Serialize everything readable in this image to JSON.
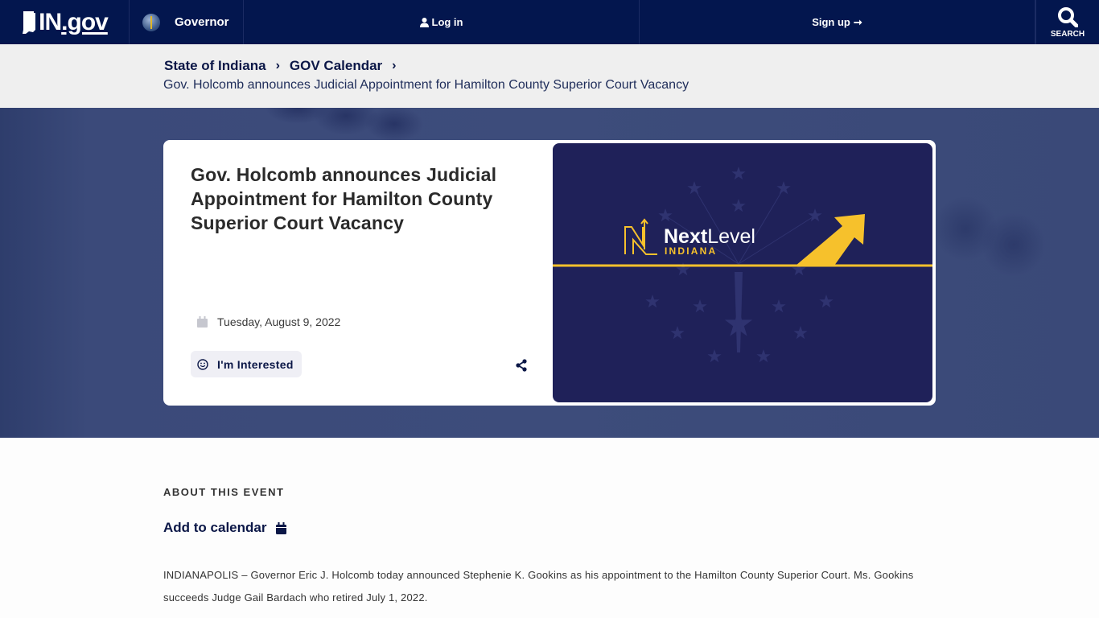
{
  "header": {
    "logo_text_in": "IN",
    "logo_text_gov": ".gov",
    "agency": "Governor",
    "login_label": "Log in",
    "signup_label": "Sign up",
    "signup_arrow": "➞",
    "search_label": "SEARCH"
  },
  "breadcrumb": {
    "items": [
      "State of Indiana",
      "GOV Calendar"
    ],
    "separator": "›",
    "current": "Gov. Holcomb announces Judicial Appointment for Hamilton County Superior Court Vacancy"
  },
  "event": {
    "title": "Gov. Holcomb announces Judicial Appointment for Hamilton County Superior Court Vacancy",
    "date": "Tuesday, August 9, 2022",
    "interest_label": "I'm Interested",
    "image": {
      "brand_next": "Next",
      "brand_level": "Level",
      "brand_state": "INDIANA"
    }
  },
  "about": {
    "heading": "ABOUT THIS EVENT",
    "add_to_calendar": "Add to calendar",
    "body": "INDIANAPOLIS – Governor Eric J. Holcomb today announced Stephenie K. Gookins as his appointment to the Hamilton County Superior Court. Ms. Gookins succeeds Judge Gail Bardach who retired July 1, 2022."
  },
  "colors": {
    "navy": "#03164e",
    "accent_gold": "#f6c12c",
    "image_bg": "#1f2159"
  }
}
